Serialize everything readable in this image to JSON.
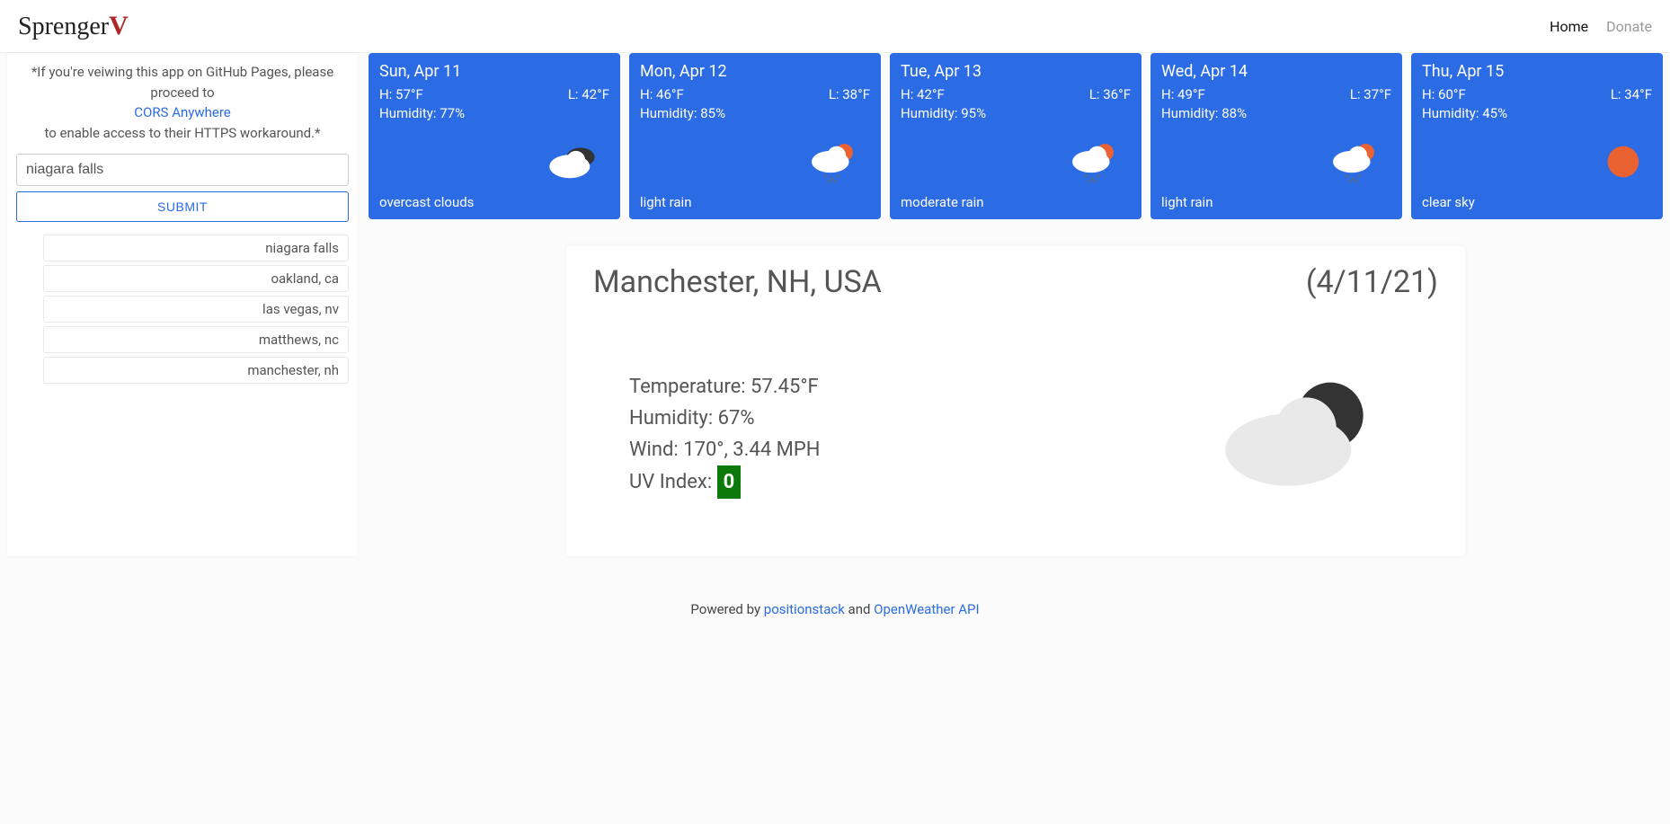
{
  "nav": {
    "brand_a": "Sprenger",
    "brand_b": "V",
    "home": "Home",
    "donate": "Donate"
  },
  "sidebar": {
    "note_a": "*If you're veiwing this app on GitHub Pages, please proceed to",
    "note_link": "CORS Anywhere",
    "note_b": "to enable access to their HTTPS workaround.*",
    "search_value": "niagara falls",
    "submit_label": "Submit",
    "history": [
      "niagara falls",
      "oakland, ca",
      "las vegas, nv",
      "matthews, nc",
      "manchester, nh"
    ]
  },
  "forecast": [
    {
      "date": "Sun, Apr 11",
      "hi": "H: 57°F",
      "lo": "L: 42°F",
      "hum": "Humidity: 77%",
      "cond": "overcast clouds",
      "icon": "overcast"
    },
    {
      "date": "Mon, Apr 12",
      "hi": "H: 46°F",
      "lo": "L: 38°F",
      "hum": "Humidity: 85%",
      "cond": "light rain",
      "icon": "lightrain"
    },
    {
      "date": "Tue, Apr 13",
      "hi": "H: 42°F",
      "lo": "L: 36°F",
      "hum": "Humidity: 95%",
      "cond": "moderate rain",
      "icon": "modrain"
    },
    {
      "date": "Wed, Apr 14",
      "hi": "H: 49°F",
      "lo": "L: 37°F",
      "hum": "Humidity: 88%",
      "cond": "light rain",
      "icon": "lightrain"
    },
    {
      "date": "Thu, Apr 15",
      "hi": "H: 60°F",
      "lo": "L: 34°F",
      "hum": "Humidity: 45%",
      "cond": "clear sky",
      "icon": "clear"
    }
  ],
  "detail": {
    "title": "Manchester, NH, USA",
    "date": "(4/11/21)",
    "temp": "Temperature: 57.45°F",
    "hum": "Humidity: 67%",
    "wind": "Wind: 170°, 3.44 MPH",
    "uv_label": "UV Index: ",
    "uv_value": "0",
    "icon": "overcast-dark"
  },
  "footer": {
    "prefix": "Powered by ",
    "link1": "positionstack",
    "mid": " and ",
    "link2": "OpenWeather API"
  }
}
